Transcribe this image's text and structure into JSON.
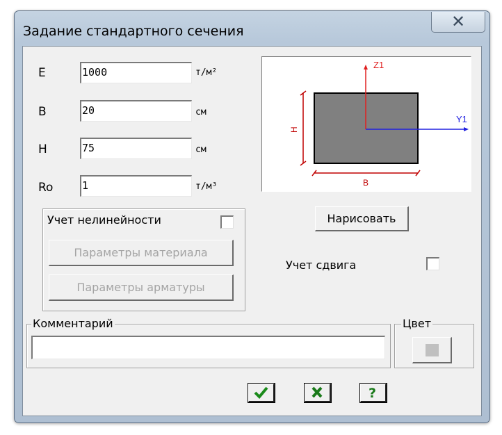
{
  "window": {
    "title": "Задание стандартного сечения",
    "close_glyph": "✕"
  },
  "fields": [
    {
      "label": "E",
      "value": "1000",
      "unit": "т/м²"
    },
    {
      "label": "B",
      "value": "20",
      "unit": "см"
    },
    {
      "label": "H",
      "value": "75",
      "unit": "см"
    },
    {
      "label": "Ro",
      "value": "1",
      "unit": "т/м³"
    }
  ],
  "preview": {
    "axis_z": "Z1",
    "axis_y": "Y1",
    "dim_h": "H",
    "dim_b": "B",
    "colors": {
      "fill": "#808080",
      "axis_z": "#e02020",
      "axis_y": "#2020e0",
      "dim": "#c00000"
    }
  },
  "draw_button": "Нарисовать",
  "nonlinear": {
    "label": "Учет нелинейности",
    "checked": false,
    "material_button": "Параметры материала",
    "rebar_button": "Параметры арматуры"
  },
  "shear": {
    "label": "Учет сдвига",
    "checked": false
  },
  "comment": {
    "legend": "Комментарий",
    "value": ""
  },
  "color": {
    "legend": "Цвет",
    "swatch": "#c0c0c0"
  },
  "footer": {
    "ok_icon": "checkmark-icon",
    "cancel_icon": "x-icon",
    "help_icon": "question-icon",
    "ok_color": "#1a8a1a",
    "cancel_color": "#1a7a1a",
    "help_color": "#1a7a1a"
  }
}
